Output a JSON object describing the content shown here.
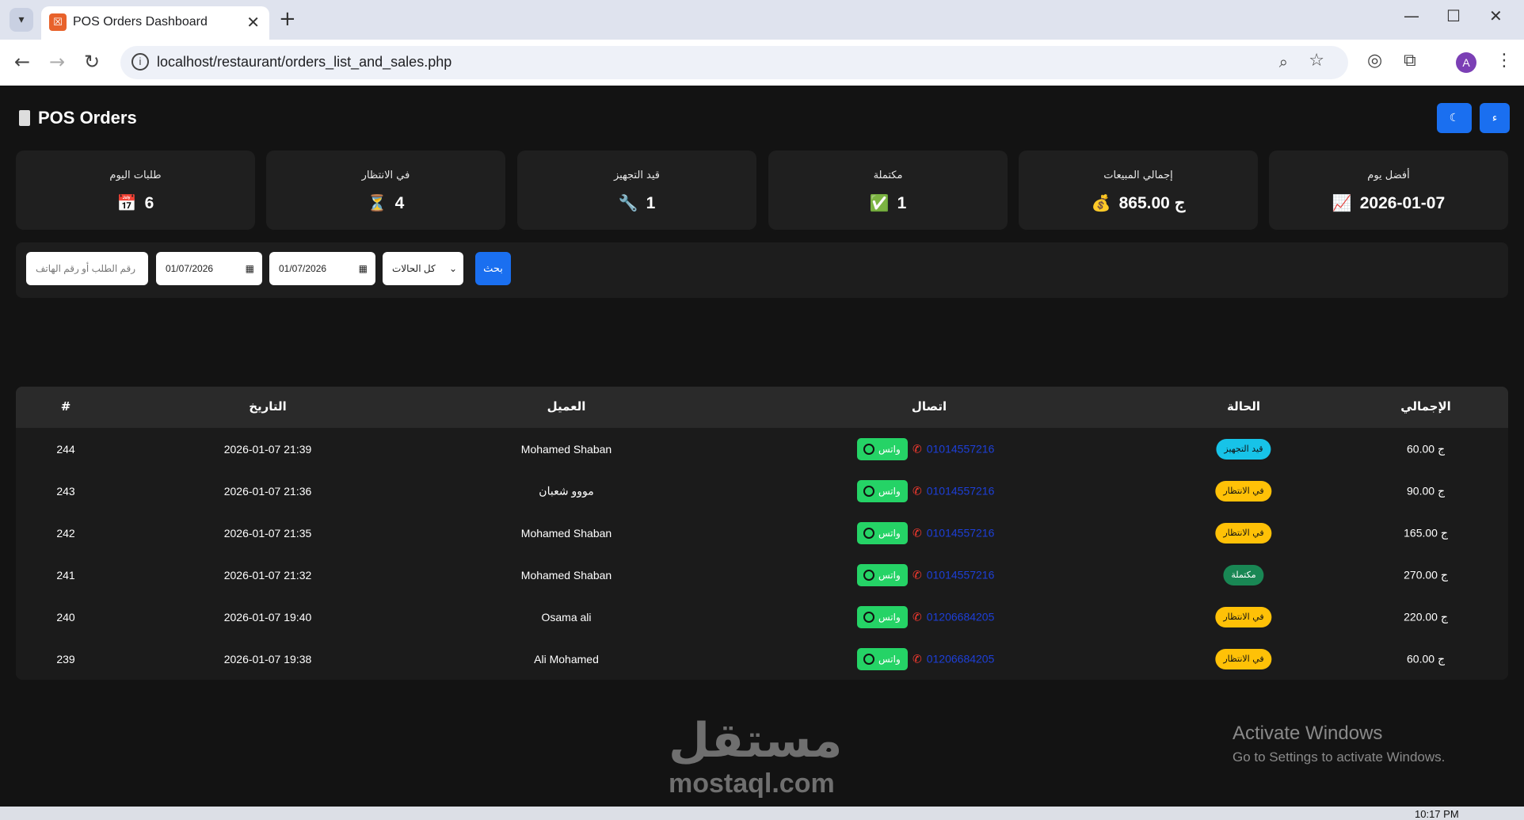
{
  "browser": {
    "tab_title": "POS Orders Dashboard",
    "url": "localhost/restaurant/orders_list_and_sales.php",
    "avatar_letter": "A"
  },
  "header": {
    "title": "POS Orders",
    "theme_toggle_icon": "moon-icon",
    "lang_toggle_icon": "translate-icon"
  },
  "stats": [
    {
      "label": "طلبات اليوم",
      "value": "6",
      "icon": "calendar-icon",
      "glyph": "📅"
    },
    {
      "label": "في الانتظار",
      "value": "4",
      "icon": "hourglass-icon",
      "glyph": "⏳"
    },
    {
      "label": "قيد التجهيز",
      "value": "1",
      "icon": "wrench-icon",
      "glyph": "🔧"
    },
    {
      "label": "مكتملة",
      "value": "1",
      "icon": "check-icon",
      "glyph": "✅"
    },
    {
      "label": "إجمالي المبيعات",
      "value": "865.00 ج",
      "icon": "money-bag-icon",
      "glyph": "💰"
    },
    {
      "label": "أفضل يوم",
      "value": "2026-01-07",
      "icon": "chart-up-icon",
      "glyph": "📈"
    }
  ],
  "filters": {
    "search_placeholder": "رقم الطلب أو رقم الهاتف",
    "date_from": "01/07/2026",
    "date_to": "01/07/2026",
    "status_selected": "كل الحالات",
    "search_button": "بحث"
  },
  "table": {
    "headers": {
      "id": "#",
      "date": "التاريخ",
      "customer": "العميل",
      "contact": "اتصال",
      "status": "الحالة",
      "total": "الإجمالي"
    },
    "whatsapp_label": "واتس",
    "rows": [
      {
        "id": "244",
        "date": "2026-01-07 21:39",
        "customer": "Mohamed Shaban",
        "phone": "01014557216",
        "status": "قيد التجهيز",
        "status_color": "#17c3e8",
        "total": "60.00 ج"
      },
      {
        "id": "243",
        "date": "2026-01-07 21:36",
        "customer": "مووو شعبان",
        "phone": "01014557216",
        "status": "في الانتظار",
        "status_color": "#ffc107",
        "total": "90.00 ج"
      },
      {
        "id": "242",
        "date": "2026-01-07 21:35",
        "customer": "Mohamed Shaban",
        "phone": "01014557216",
        "status": "في الانتظار",
        "status_color": "#ffc107",
        "total": "165.00 ج"
      },
      {
        "id": "241",
        "date": "2026-01-07 21:32",
        "customer": "Mohamed Shaban",
        "phone": "01014557216",
        "status": "مكتملة",
        "status_color": "#198754",
        "total": "270.00 ج"
      },
      {
        "id": "240",
        "date": "2026-01-07 19:40",
        "customer": "Osama ali",
        "phone": "01206684205",
        "status": "في الانتظار",
        "status_color": "#ffc107",
        "total": "220.00 ج"
      },
      {
        "id": "239",
        "date": "2026-01-07 19:38",
        "customer": "Ali Mohamed",
        "phone": "01206684205",
        "status": "في الانتظار",
        "status_color": "#ffc107",
        "total": "60.00 ج"
      }
    ]
  },
  "watermarks": {
    "windows_line1": "Activate Windows",
    "windows_line2": "Go to Settings to activate Windows.",
    "logo_ar": "مستقل",
    "logo_en": "mostaql.com"
  },
  "taskbar": {
    "clock": "10:17 PM"
  }
}
